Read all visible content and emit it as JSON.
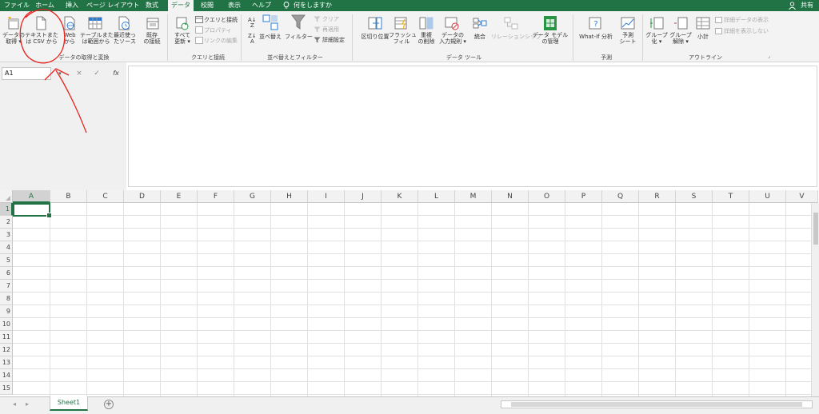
{
  "colors": {
    "excel_green": "#217346",
    "annotation_red": "#e8201c"
  },
  "tabs": [
    "ファイル",
    "ホーム",
    "挿入",
    "ページ レイアウト",
    "数式",
    "データ",
    "校閲",
    "表示",
    "ヘルプ",
    "何をしますか"
  ],
  "share_label": "共有",
  "ribbon": {
    "get_data": {
      "line1": "データの",
      "line2": "取得 ▾"
    },
    "text_csv": {
      "line1": "テキストまた",
      "line2": "は CSV から"
    },
    "web": {
      "line1": "Web",
      "line2": "から"
    },
    "from_table": {
      "line1": "テーブルまた",
      "line2": "は範囲から"
    },
    "recent_sources": {
      "line1": "最近使っ",
      "line2": "たソース"
    },
    "existing": {
      "line1": "既存",
      "line2": "の接続"
    },
    "group_get_transform": "データの取得と変換",
    "refresh_all": {
      "line1": "すべて",
      "line2": "更新 ▾"
    },
    "queries_connections": "クエリと接続",
    "properties": "プロパティ",
    "edit_links": "リンクの編集",
    "group_queries": "クエリと接続",
    "sort": "並べ替え",
    "filter": "フィルター",
    "clear": "クリア",
    "reapply": "再適用",
    "advanced": "詳細設定",
    "group_sort_filter": "並べ替えとフィルター",
    "text_to_columns": "区切り位置",
    "flash_fill": {
      "line1": "フラッシュ",
      "line2": "フィル"
    },
    "remove_duplicates": {
      "line1": "重複",
      "line2": "の削除"
    },
    "data_validation": {
      "line1": "データの",
      "line2": "入力規則 ▾"
    },
    "consolidate": "統合",
    "relationships": "リレーションシップ",
    "data_model": {
      "line1": "データ モデル",
      "line2": "の管理"
    },
    "group_data_tools": "データ ツール",
    "what_if": "What-If 分析",
    "forecast_sheet": {
      "line1": "予測",
      "line2": "シート"
    },
    "group_forecast": "予測",
    "group": {
      "line1": "グループ",
      "line2": "化 ▾"
    },
    "ungroup": {
      "line1": "グループ",
      "line2": "解除 ▾"
    },
    "subtotal": "小計",
    "show_detail": "詳細データの表示",
    "hide_detail": "詳細を表示しない",
    "group_outline": "アウトライン"
  },
  "formula_bar": {
    "name_box": "A1",
    "cancel": "×",
    "enter": "✓",
    "fx": "fx"
  },
  "columns": [
    "A",
    "B",
    "C",
    "D",
    "E",
    "F",
    "G",
    "H",
    "I",
    "J",
    "K",
    "L",
    "M",
    "N",
    "O",
    "P",
    "Q",
    "R",
    "S",
    "T",
    "U",
    "V"
  ],
  "rows": [
    "1",
    "2",
    "3",
    "4",
    "5",
    "6",
    "7",
    "8",
    "9",
    "10",
    "11",
    "12",
    "13",
    "14",
    "15"
  ],
  "selected_cell": "A1",
  "sheets": [
    "Sheet1"
  ]
}
